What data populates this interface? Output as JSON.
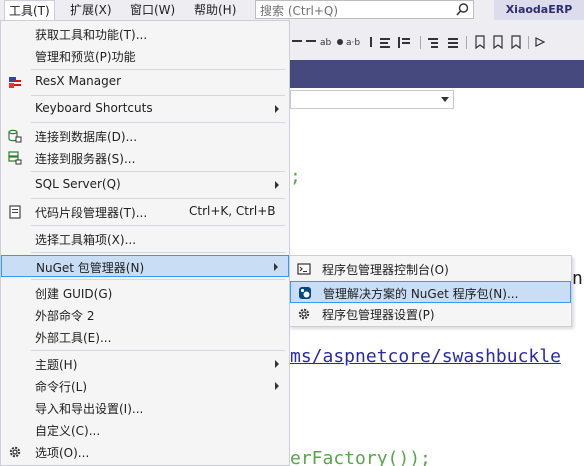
{
  "menubar": {
    "items": [
      "工具(T)",
      "扩展(X)",
      "窗口(W)",
      "帮助(H)"
    ],
    "search_placeholder": "搜索 (Ctrl+Q)",
    "app_name": "XiaodaERP"
  },
  "editor": {
    "code1": ";",
    "code2": "ms/aspnetcore/swashbuckle",
    "code3": "erFactory());",
    "code4": "ng"
  },
  "tools_menu": {
    "items": [
      {
        "label": "获取工具和功能(T)..."
      },
      {
        "label": "管理和预览(P)功能"
      },
      {
        "label": "ResX Manager",
        "icon": "resx-flag-icon"
      },
      {
        "label": "Keyboard Shortcuts",
        "submenu": true
      },
      {
        "label": "连接到数据库(D)...",
        "icon": "database-connect-icon"
      },
      {
        "label": "连接到服务器(S)...",
        "icon": "server-connect-icon"
      },
      {
        "label": "SQL Server(Q)",
        "submenu": true
      },
      {
        "label": "代码片段管理器(T)...",
        "shortcut": "Ctrl+K, Ctrl+B",
        "icon": "snippet-icon"
      },
      {
        "label": "选择工具箱项(X)..."
      },
      {
        "label": "NuGet 包管理器(N)",
        "submenu": true,
        "highlighted": true
      },
      {
        "label": "创建 GUID(G)"
      },
      {
        "label": "外部命令 2"
      },
      {
        "label": "外部工具(E)..."
      },
      {
        "label": "主题(H)",
        "submenu": true
      },
      {
        "label": "命令行(L)",
        "submenu": true
      },
      {
        "label": "导入和导出设置(I)..."
      },
      {
        "label": "自定义(C)..."
      },
      {
        "label": "选项(O)...",
        "icon": "gear-icon"
      }
    ]
  },
  "nuget_submenu": {
    "items": [
      {
        "label": "程序包管理器控制台(O)",
        "icon": "console-icon"
      },
      {
        "label": "管理解决方案的 NuGet 程序包(N)...",
        "icon": "nuget-icon",
        "highlighted": true
      },
      {
        "label": "程序包管理器设置(P)",
        "icon": "gear-icon"
      }
    ]
  },
  "colors": {
    "menu_bg": "#f5f5f5",
    "highlight_bg": "#c9def5",
    "highlight_border": "#3399ff",
    "title_strip": "#45497e",
    "code_green": "#57a64a",
    "code_link": "#2a2aa8"
  }
}
